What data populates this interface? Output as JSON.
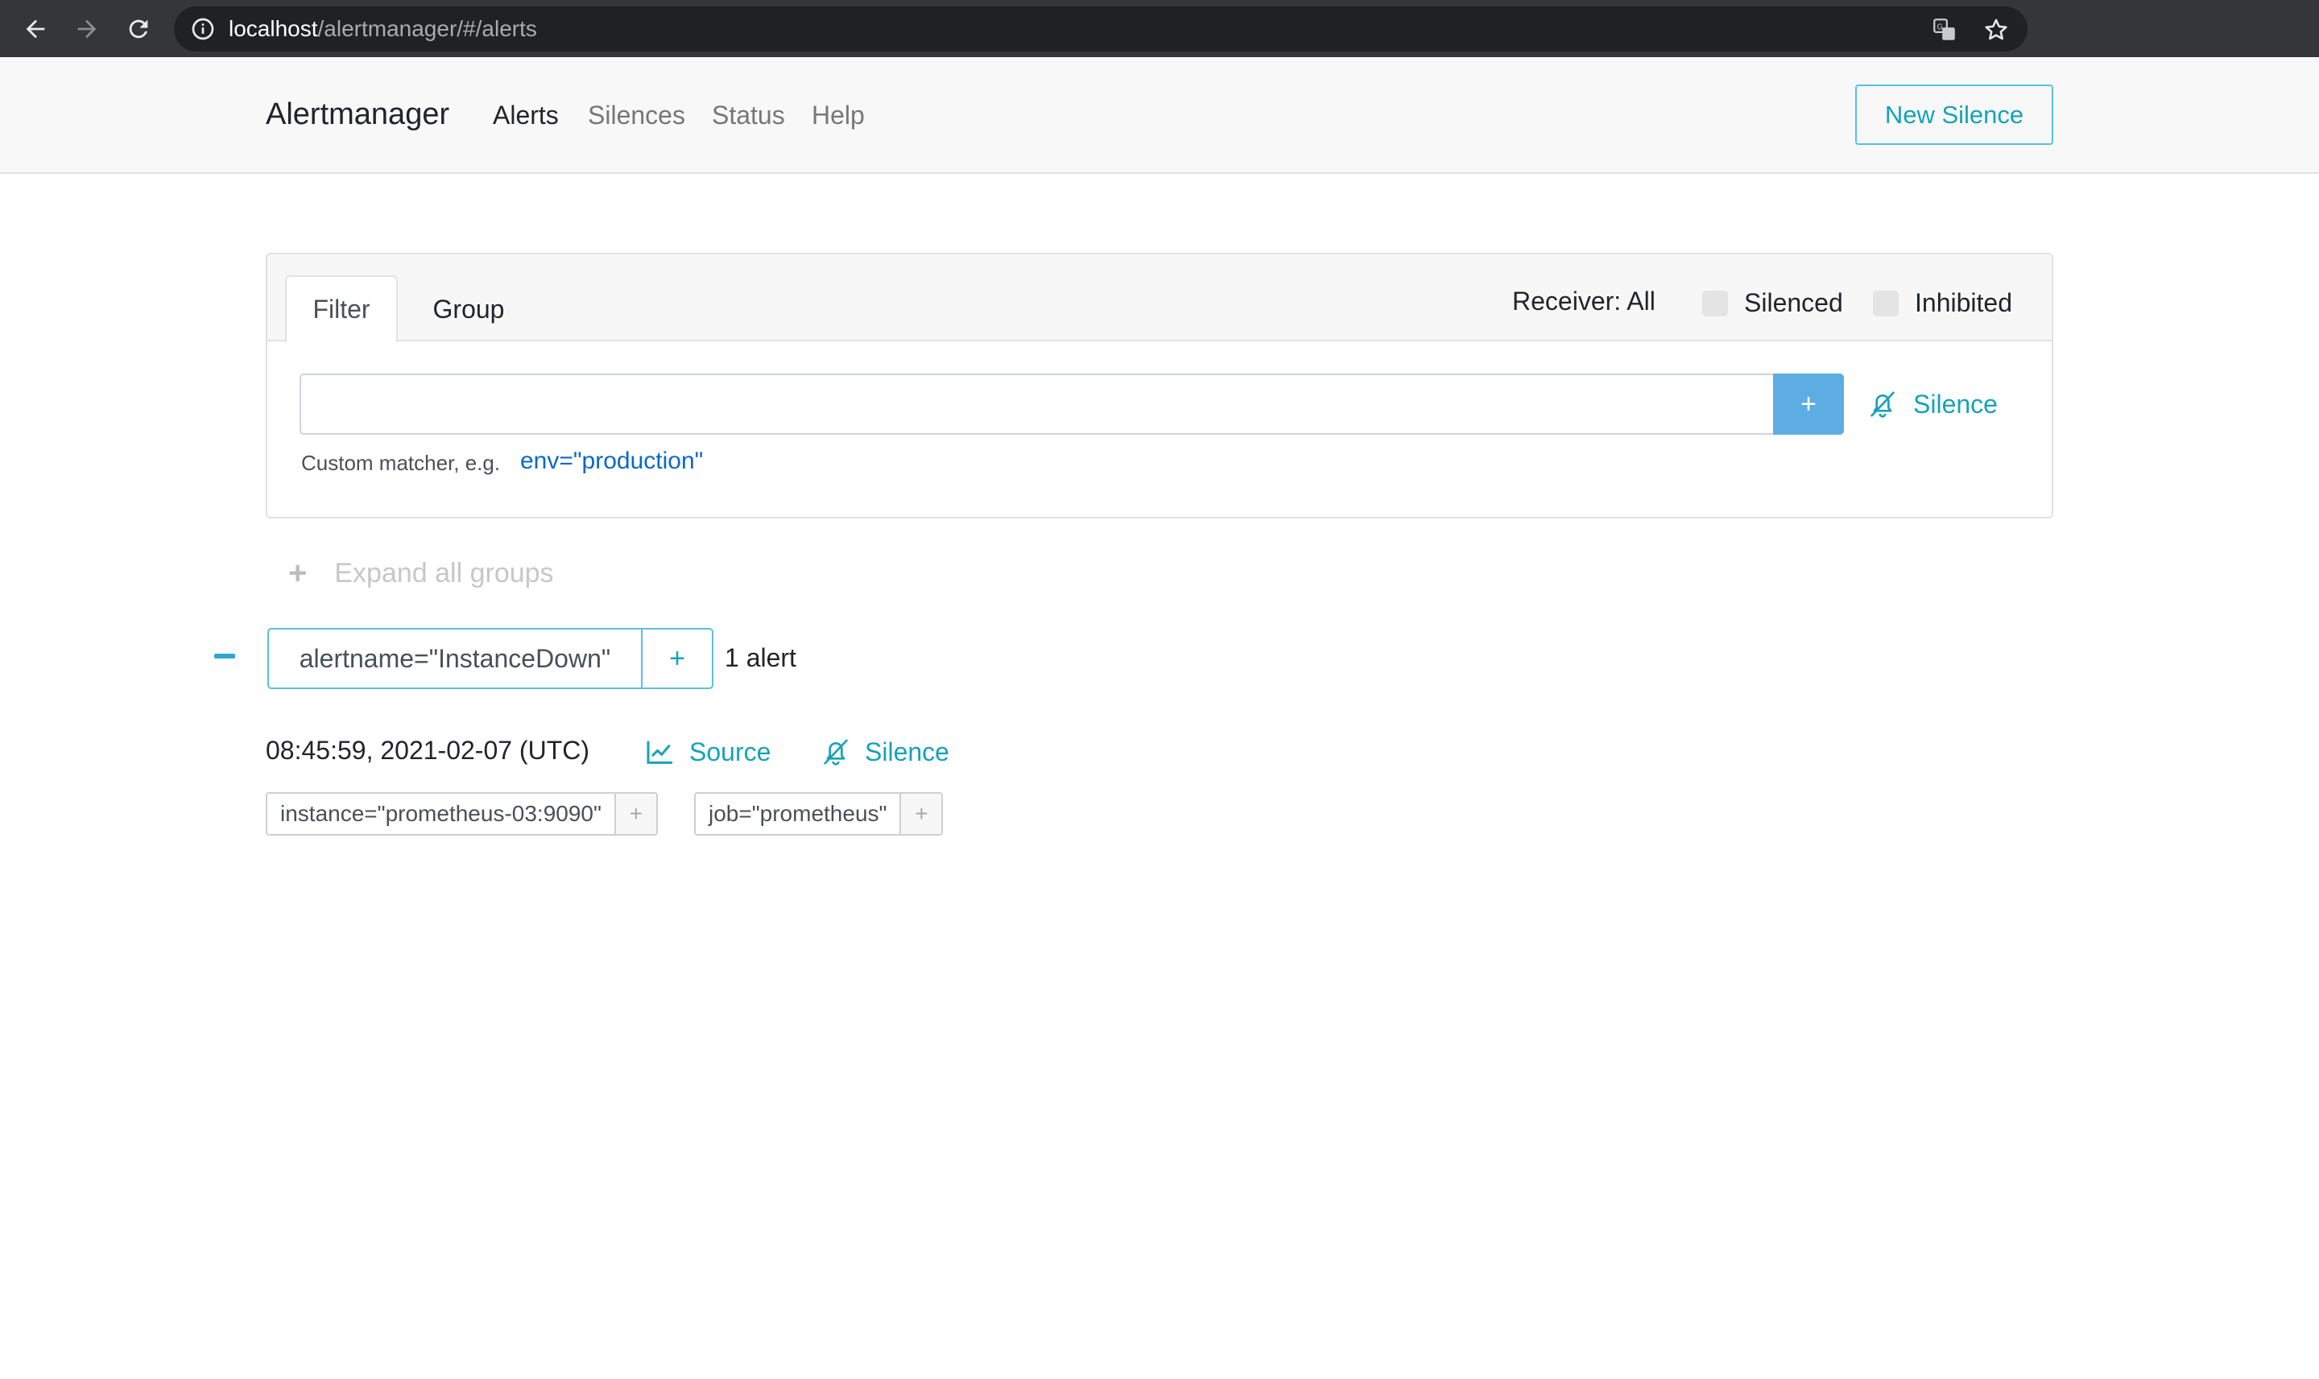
{
  "browser": {
    "url_host": "localhost",
    "url_path": "/alertmanager/#/alerts",
    "icons": [
      "back-arrow-icon",
      "forward-arrow-icon",
      "reload-icon",
      "info-icon",
      "translate-icon",
      "star-icon"
    ]
  },
  "navbar": {
    "brand": "Alertmanager",
    "links": [
      "Alerts",
      "Silences",
      "Status",
      "Help"
    ],
    "active": "Alerts",
    "new_silence_label": "New Silence"
  },
  "filter_card": {
    "tabs": [
      "Filter",
      "Group"
    ],
    "active_tab": "Filter",
    "receiver": "Receiver: All",
    "silenced_label": "Silenced",
    "inhibited_label": "Inhibited",
    "input_value": "",
    "add_label": "+",
    "silence_label": "Silence",
    "hint_text": "Custom matcher, e.g.",
    "hint_example": "env=\"production\""
  },
  "expand_all": {
    "icon": "+",
    "label": "Expand all groups"
  },
  "groups": [
    {
      "collapse_icon": "minus-icon",
      "label": "alertname=\"InstanceDown\"",
      "add_label": "+",
      "count": "1 alert",
      "alerts": [
        {
          "time": "08:45:59, 2021-02-07 (UTC)",
          "source_label": "Source",
          "silence_label": "Silence",
          "labels": [
            {
              "text": "instance=\"prometheus-03:9090\"",
              "add": "+"
            },
            {
              "text": "job=\"prometheus\"",
              "add": "+"
            }
          ]
        }
      ]
    }
  ],
  "colors": {
    "accent": "#17a2b8",
    "add_button": "#5dade2",
    "link": "#0a68c6",
    "chrome_bg": "#35363a"
  }
}
